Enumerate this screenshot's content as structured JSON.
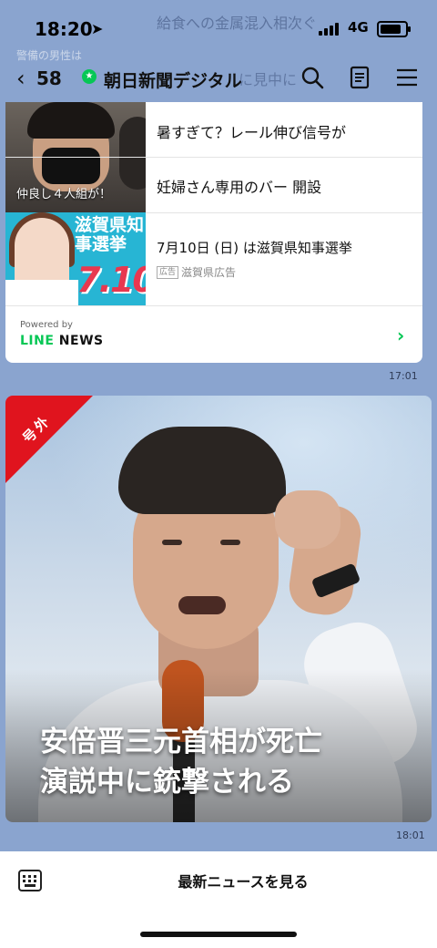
{
  "status_bar": {
    "time": "18:20",
    "network": "4G",
    "location_glyph": "➤"
  },
  "background_ghost_text": {
    "line1": "給食への金属混入相次ぐ",
    "line2": "警備の男性は",
    "line3": "に見中に"
  },
  "header": {
    "back_glyph": "‹",
    "unread_count": "58",
    "channel_name": "朝日新聞デジタル",
    "official_badge": "★"
  },
  "news_card": {
    "items": [
      {
        "title": "暑すぎて？レール伸び信号が"
      },
      {
        "title": "妊婦さん専用のバー 開設"
      }
    ],
    "thumb_caption": "仲良し４人組が！",
    "ad": {
      "image_text_top": "滋賀県知事選挙",
      "image_text_date": "7.10",
      "title": "7月10日 (日) は滋賀県知事選挙",
      "badge": "広告",
      "sponsor": "滋賀県広告"
    },
    "powered_by": "Powered by",
    "brand_line": "LINE",
    "brand_news": " NEWS",
    "chevron": "›"
  },
  "timestamps": {
    "first": "17:01",
    "second": "18:01"
  },
  "breaking": {
    "ribbon": "号外",
    "headline_line1": "安倍晋三元首相が死亡",
    "headline_line2": "演説中に銃撃される"
  },
  "bottom_bar": {
    "label": "最新ニュースを見る"
  },
  "colors": {
    "chat_bg": "#8aa4cf",
    "line_green": "#06c755",
    "ribbon_red": "#e0141e"
  }
}
